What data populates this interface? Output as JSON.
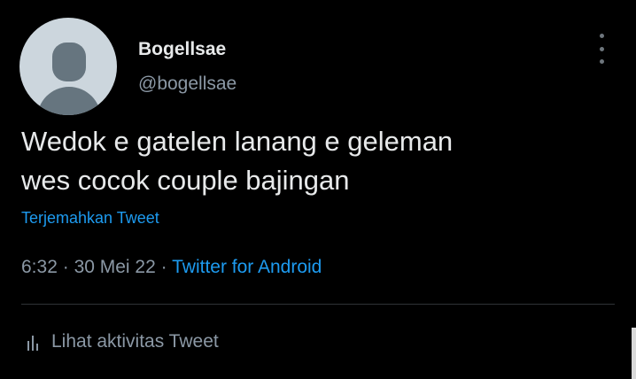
{
  "user": {
    "display_name": "Bogellsae",
    "handle": "@bogellsae"
  },
  "tweet": {
    "lines": [
      "Wedok e gatelen lanang e geleman",
      "wes cocok couple bajingan"
    ],
    "translate_label": "Terjemahkan Tweet",
    "time": "6:32",
    "separator": "·",
    "date": "30 Mei 22",
    "source": "Twitter for Android"
  },
  "activity": {
    "label": "Lihat aktivitas Tweet",
    "icon": "bar-chart-icon"
  },
  "menu": {
    "icon": "more-vertical-icon"
  },
  "colors": {
    "background": "#000000",
    "text_primary": "#e7e9ea",
    "text_secondary": "#8b98a5",
    "accent": "#1d9bf0",
    "divider": "#2f3336"
  }
}
